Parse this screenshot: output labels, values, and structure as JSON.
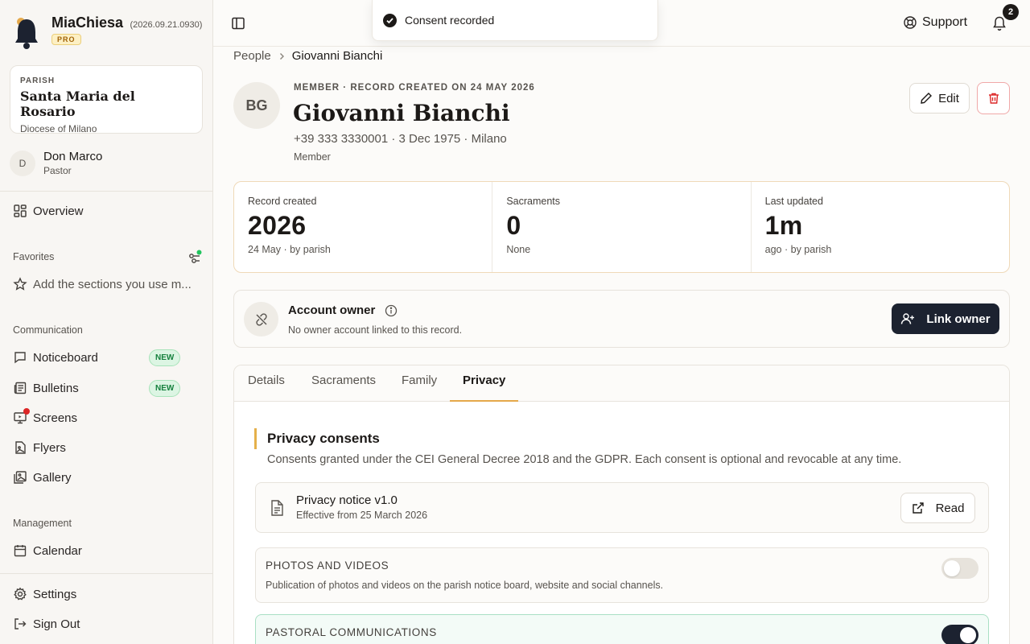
{
  "app": {
    "name": "MiaChiesa",
    "version": "(2026.09.21.0930)",
    "plan_badge": "PRO"
  },
  "parish": {
    "label": "PARISH",
    "name": "Santa Maria del Rosario",
    "diocese": "Diocese of Milano"
  },
  "user": {
    "initial": "D",
    "name": "Don Marco",
    "role": "Pastor"
  },
  "sidebar": {
    "overview": "Overview",
    "favorites_label": "Favorites",
    "favorites_placeholder": "Add the sections you use m...",
    "communication_label": "Communication",
    "communication_items": [
      {
        "label": "Noticeboard",
        "badge": "NEW",
        "icon": "message-square-icon"
      },
      {
        "label": "Bulletins",
        "badge": "NEW",
        "icon": "newspaper-icon"
      },
      {
        "label": "Screens",
        "icon": "monitor-icon"
      },
      {
        "label": "Flyers",
        "icon": "file-image-icon"
      },
      {
        "label": "Gallery",
        "icon": "images-icon"
      }
    ],
    "management_label": "Management",
    "calendar": "Calendar",
    "settings": "Settings",
    "sign_out": "Sign Out"
  },
  "topbar": {
    "toast": "Consent recorded",
    "support": "Support",
    "notification_count": "2"
  },
  "breadcrumb": {
    "parent": "People",
    "current": "Giovanni Bianchi"
  },
  "person": {
    "initials": "BG",
    "meta": "MEMBER · RECORD CREATED ON 24 MAY 2026",
    "name": "Giovanni Bianchi",
    "info": "+39 333 3330001 · 3 Dec 1975 · Milano",
    "role": "Member",
    "edit_label": "Edit"
  },
  "stats": [
    {
      "label": "Record created",
      "value": "2026",
      "sub": "24 May · by parish"
    },
    {
      "label": "Sacraments",
      "value": "0",
      "sub": "None"
    },
    {
      "label": "Last updated",
      "value": "1m",
      "sub": "ago · by parish"
    }
  ],
  "owner": {
    "title": "Account owner",
    "subtitle": "No owner account linked to this record.",
    "button": "Link owner"
  },
  "tabs": [
    "Details",
    "Sacraments",
    "Family",
    "Privacy"
  ],
  "active_tab": "Privacy",
  "privacy": {
    "title": "Privacy consents",
    "subtitle": "Consents granted under the CEI General Decree 2018 and the GDPR. Each consent is optional and revocable at any time.",
    "notice_title": "Privacy notice v1.0",
    "notice_sub": "Effective from 25 March 2026",
    "read_label": "Read",
    "consents": [
      {
        "title": "PHOTOS AND VIDEOS",
        "description": "Publication of photos and videos on the parish notice board, website and social channels.",
        "enabled": false
      },
      {
        "title": "PASTORAL COMMUNICATIONS",
        "description": "",
        "enabled": true
      }
    ]
  },
  "colors": {
    "accent": "#e5a84a",
    "primary_dark": "#1c2230",
    "success": "#15803d",
    "danger": "#dc2626"
  }
}
